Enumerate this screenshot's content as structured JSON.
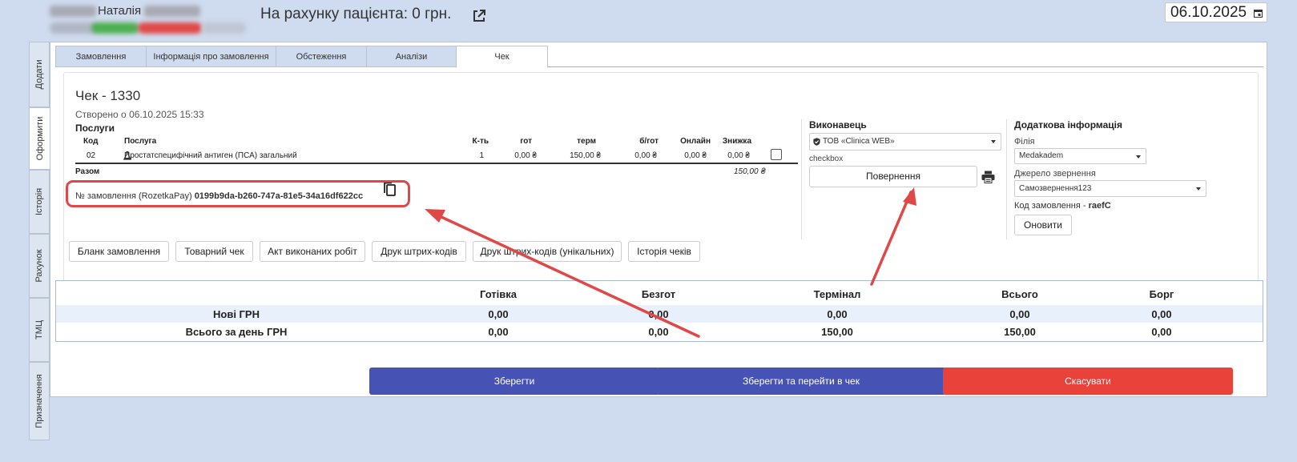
{
  "header": {
    "patient_name": "Наталія",
    "balance": "На рахунку пацієнта: 0 грн.",
    "date": "06.10.2025"
  },
  "side_tabs": [
    "Додати",
    "Оформити",
    "Історія",
    "Рахунок",
    "ТМЦ",
    "Призначення"
  ],
  "tabs": [
    "Замовлення",
    "Інформація про замовлення",
    "Обстеження",
    "Аналізи",
    "Чек"
  ],
  "check": {
    "title": "Чек - 1330",
    "created": "Створено о 06.10.2025 15:33",
    "services_label": "Послуги",
    "columns": [
      "Код",
      "Послуга",
      "К-ть",
      "гот",
      "терм",
      "б/гот",
      "Онлайн",
      "Знижка"
    ],
    "rows": [
      {
        "code": "02",
        "service": "Простатспецифічний антиген (ПСА) загальний",
        "qty": "1",
        "cash": "0,00 ₴",
        "terminal": "150,00 ₴",
        "cashless": "0,00 ₴",
        "online": "0,00 ₴",
        "discount": "0,00 ₴"
      }
    ],
    "total_label": "Разом",
    "total_value": "150,00 ₴",
    "order_prefix": "№ замовлення (RozetkaPay)",
    "order_id": "0199b9da-b260-747a-81e5-34a16df622cc"
  },
  "buttons": [
    "Бланк замовлення",
    "Товарний чек",
    "Акт виконаних робіт",
    "Друк штрих-кодів",
    "Друк штрих-кодів (унікальних)",
    "Історія чеків"
  ],
  "executor": {
    "label": "Виконавець",
    "selected": "ТОВ «Clinica WEB»",
    "checkbox_label": "checkbox",
    "return_button": "Повернення"
  },
  "additional": {
    "label": "Додаткова інформація",
    "branch_label": "Філія",
    "branch_value": "Medakadem",
    "source_label": "Джерело звернення",
    "source_value": "Самозвернення123",
    "order_code_label": "Код замовлення -",
    "order_code_value": "raefC",
    "refresh_button": "Оновити"
  },
  "totals": {
    "columns": [
      "Готівка",
      "Безгот",
      "Термінал",
      "Всього",
      "Борг"
    ],
    "rows": [
      {
        "label": "Нові ГРН",
        "values": [
          "0,00",
          "0,00",
          "0,00",
          "0,00",
          "0,00"
        ]
      },
      {
        "label": "Всього за день ГРН",
        "values": [
          "0,00",
          "0,00",
          "150,00",
          "150,00",
          "0,00"
        ]
      }
    ]
  },
  "actions": {
    "save": "Зберегти",
    "save_and_go": "Зберегти та перейти в чек",
    "cancel": "Скасувати"
  },
  "colors": {
    "primary": "#4652b4",
    "danger": "#e8423a",
    "annotation": "#e04848",
    "background": "#cfdbee"
  }
}
